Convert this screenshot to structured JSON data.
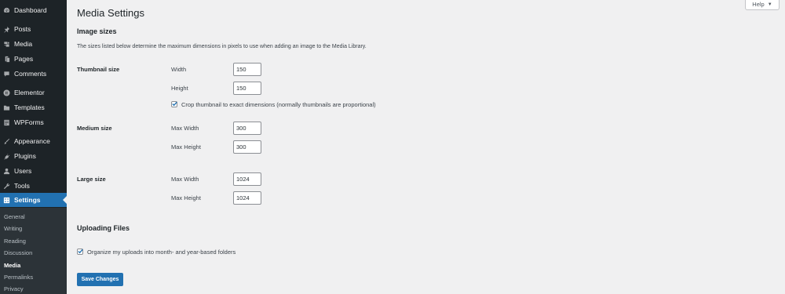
{
  "sidebar": {
    "items": [
      {
        "label": "Dashboard",
        "icon": "dashboard-icon"
      },
      {
        "label": "Posts",
        "icon": "pin-icon"
      },
      {
        "label": "Media",
        "icon": "media-icon"
      },
      {
        "label": "Pages",
        "icon": "pages-icon"
      },
      {
        "label": "Comments",
        "icon": "comment-icon"
      },
      {
        "label": "Elementor",
        "icon": "elementor-icon"
      },
      {
        "label": "Templates",
        "icon": "folder-icon"
      },
      {
        "label": "WPForms",
        "icon": "form-icon"
      },
      {
        "label": "Appearance",
        "icon": "brush-icon"
      },
      {
        "label": "Plugins",
        "icon": "plug-icon"
      },
      {
        "label": "Users",
        "icon": "user-icon"
      },
      {
        "label": "Tools",
        "icon": "wrench-icon"
      },
      {
        "label": "Settings",
        "icon": "settings-icon"
      }
    ],
    "submenu": [
      "General",
      "Writing",
      "Reading",
      "Discussion",
      "Media",
      "Permalinks",
      "Privacy"
    ],
    "active_color": "#2271b1",
    "background": "#1d2327"
  },
  "help": {
    "label": "Help",
    "arrow": "▼"
  },
  "page": {
    "title": "Media Settings",
    "image_sizes": {
      "title": "Image sizes",
      "description": "The sizes listed below determine the maximum dimensions in pixels to use when adding an image to the Media Library.",
      "thumbnail": {
        "label": "Thumbnail size",
        "width_label": "Width",
        "width": "150",
        "height_label": "Height",
        "height": "150",
        "crop_label": "Crop thumbnail to exact dimensions (normally thumbnails are proportional)",
        "crop_checked": true
      },
      "medium": {
        "label": "Medium size",
        "width_label": "Max Width",
        "width": "300",
        "height_label": "Max Height",
        "height": "300"
      },
      "large": {
        "label": "Large size",
        "width_label": "Max Width",
        "width": "1024",
        "height_label": "Max Height",
        "height": "1024"
      }
    },
    "uploading": {
      "title": "Uploading Files",
      "organize_label": "Organize my uploads into month- and year-based folders",
      "organize_checked": true
    },
    "save_label": "Save Changes"
  }
}
